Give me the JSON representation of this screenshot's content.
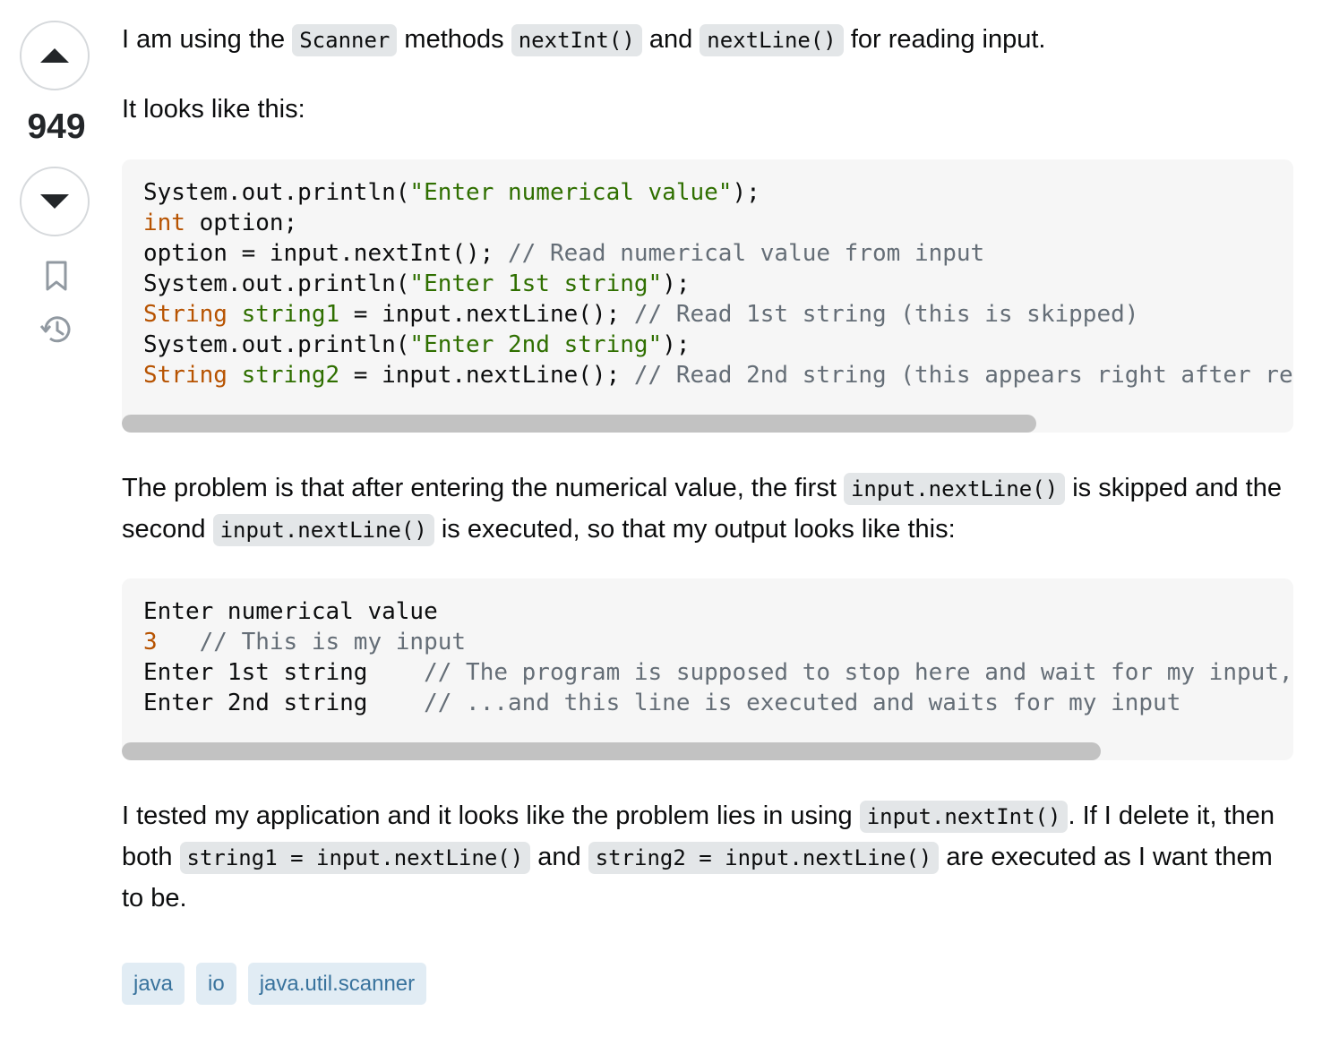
{
  "vote": {
    "score": "949",
    "upvote_icon": "triangle-up-icon",
    "downvote_icon": "triangle-down-icon"
  },
  "side": {
    "bookmark_icon": "bookmark-icon",
    "history_icon": "history-icon"
  },
  "para1": {
    "t1": "I am using the ",
    "c1": "Scanner",
    "t2": " methods ",
    "c2": "nextInt()",
    "t3": " and ",
    "c3": "nextLine()",
    "t4": " for reading input."
  },
  "para2": "It looks like this:",
  "code1": {
    "l1a": "System.out.println(",
    "l1b": "\"Enter numerical value\"",
    "l1c": ");",
    "l2a": "int",
    "l2b": " option;",
    "l3a": "option = input.nextInt(); ",
    "l3b": "// Read numerical value from input",
    "l4a": "System.out.println(",
    "l4b": "\"Enter 1st string\"",
    "l4c": ");",
    "l5a": "String",
    "l5b": " ",
    "l5c": "string1",
    "l5d": " = input.nextLine(); ",
    "l5e": "// Read 1st string (this is skipped)",
    "l6a": "System.out.println(",
    "l6b": "\"Enter 2nd string\"",
    "l6c": ");",
    "l7a": "String",
    "l7b": " ",
    "l7c": "string2",
    "l7d": " = input.nextLine(); ",
    "l7e": "// Read 2nd string (this appears right after re"
  },
  "para3": {
    "t1": "The problem is that after entering the numerical value, the first ",
    "c1": "input.nextLine()",
    "t2": " is skipped and the second ",
    "c2": "input.nextLine()",
    "t3": " is executed, so that my output looks like this:"
  },
  "code2": {
    "l1": "Enter numerical value",
    "l2a": "3",
    "l2b": "   ",
    "l2c": "// This is my input",
    "l3a": "Enter 1st string    ",
    "l3b": "// The program is supposed to stop here and wait for my input,",
    "l4a": "Enter 2nd string    ",
    "l4b": "// ...and this line is executed and waits for my input"
  },
  "para4": {
    "t1": "I tested my application and it looks like the problem lies in using ",
    "c1": "input.nextInt()",
    "t2": ". If I delete it, then both ",
    "c2": "string1 = input.nextLine()",
    "t3": " and ",
    "c3": "string2 = input.nextLine()",
    "t4": " are executed as I want them to be."
  },
  "tags": [
    "java",
    "io",
    "java.util.scanner"
  ],
  "colors": {
    "tag_bg": "#e1ecf4",
    "tag_text": "#39739d",
    "code_bg": "#f6f6f6"
  }
}
